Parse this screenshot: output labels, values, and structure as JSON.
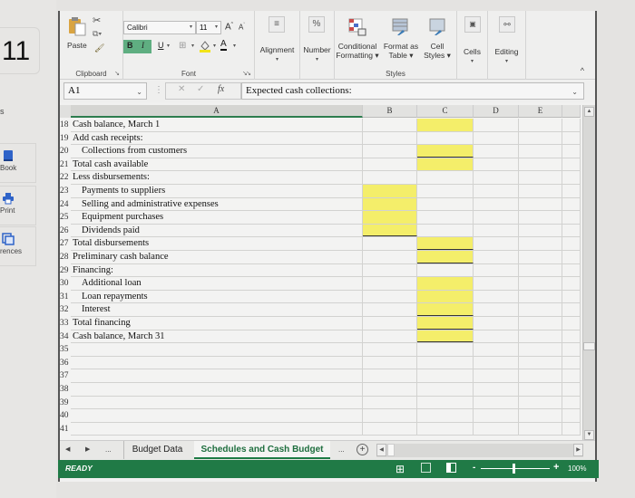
{
  "outer_app": {
    "question_number": "11",
    "partial_label": "s",
    "side_buttons": [
      {
        "label": "Book",
        "icon": "book-icon"
      },
      {
        "label": "Print",
        "icon": "print-icon"
      },
      {
        "label": "rences",
        "icon": "references-icon"
      }
    ]
  },
  "ribbon": {
    "clipboard": {
      "paste_label": "Paste",
      "group_label": "Clipboard"
    },
    "font": {
      "font_name": "Calibri",
      "font_size": "11",
      "bold": "B",
      "italic": "I",
      "underline": "U",
      "font_color": "A",
      "grow": "A",
      "shrink": "A",
      "group_label": "Font"
    },
    "alignment_label": "Alignment",
    "number_label": "Number",
    "number_icon": "%",
    "styles": {
      "conditional_formatting": [
        "Conditional",
        "Formatting"
      ],
      "format_as_table": [
        "Format as",
        "Table"
      ],
      "cell_styles": [
        "Cell",
        "Styles"
      ],
      "group_label": "Styles"
    },
    "cells_label": "Cells",
    "editing_label": "Editing"
  },
  "formula_bar": {
    "name_box": "A1",
    "formula": "Expected cash collections:",
    "fx": "fx"
  },
  "grid": {
    "columns": [
      "A",
      "B",
      "C",
      "D",
      "E"
    ],
    "rows": [
      {
        "num": "18",
        "label": "Cash balance, March 1",
        "indent": false,
        "b": false,
        "c": true
      },
      {
        "num": "19",
        "label": "Add cash receipts:",
        "indent": false,
        "b": false,
        "c": false
      },
      {
        "num": "20",
        "label": "Collections from customers",
        "indent": true,
        "b": false,
        "c": true
      },
      {
        "num": "21",
        "label": "Total cash available",
        "indent": false,
        "b": false,
        "c": true
      },
      {
        "num": "22",
        "label": "Less disbursements:",
        "indent": false,
        "b": false,
        "c": false
      },
      {
        "num": "23",
        "label": "Payments to suppliers",
        "indent": true,
        "b": true,
        "c": false
      },
      {
        "num": "24",
        "label": "Selling and administrative expenses",
        "indent": true,
        "b": true,
        "c": false
      },
      {
        "num": "25",
        "label": "Equipment purchases",
        "indent": true,
        "b": true,
        "c": false
      },
      {
        "num": "26",
        "label": "Dividends paid",
        "indent": true,
        "b": true,
        "c": false
      },
      {
        "num": "27",
        "label": "Total disbursements",
        "indent": false,
        "b": false,
        "c": true
      },
      {
        "num": "28",
        "label": "Preliminary cash balance",
        "indent": false,
        "b": false,
        "c": true
      },
      {
        "num": "29",
        "label": "Financing:",
        "indent": false,
        "b": false,
        "c": false
      },
      {
        "num": "30",
        "label": "Additional loan",
        "indent": true,
        "b": false,
        "c": true
      },
      {
        "num": "31",
        "label": "Loan repayments",
        "indent": true,
        "b": false,
        "c": true
      },
      {
        "num": "32",
        "label": "Interest",
        "indent": true,
        "b": false,
        "c": true
      },
      {
        "num": "33",
        "label": "Total financing",
        "indent": false,
        "b": false,
        "c": true
      },
      {
        "num": "34",
        "label": "Cash balance, March 31",
        "indent": false,
        "b": false,
        "c": true
      },
      {
        "num": "35",
        "label": "",
        "indent": false,
        "b": false,
        "c": false
      },
      {
        "num": "36",
        "label": "",
        "indent": false,
        "b": false,
        "c": false
      },
      {
        "num": "37",
        "label": "",
        "indent": false,
        "b": false,
        "c": false
      },
      {
        "num": "38",
        "label": "",
        "indent": false,
        "b": false,
        "c": false
      },
      {
        "num": "39",
        "label": "",
        "indent": false,
        "b": false,
        "c": false
      },
      {
        "num": "40",
        "label": "",
        "indent": false,
        "b": false,
        "c": false
      },
      {
        "num": "41",
        "label": "",
        "indent": false,
        "b": false,
        "c": false
      }
    ],
    "input_cell_color": "#f4ee6a"
  },
  "sheet_tabs": {
    "more": "...",
    "tabs": [
      {
        "label": "Budget Data",
        "active": false
      },
      {
        "label": "Schedules and Cash Budget",
        "active": true
      }
    ]
  },
  "status_bar": {
    "mode": "READY",
    "zoom_level": "100%",
    "zoom_minus": "-",
    "zoom_plus": "+",
    "accent": "#207a46"
  }
}
